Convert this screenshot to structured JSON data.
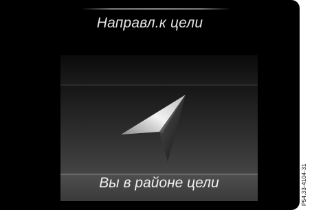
{
  "screen": {
    "title": "Направл.к цели",
    "status_message": "Вы в районе цели",
    "direction_icon": "navigation-arrow-icon"
  },
  "figure_ref": "P54.33-4104-31",
  "colors": {
    "screen_bg": "#000000",
    "text": "#e6e6e6",
    "arrow_light": "#e0e0e0",
    "arrow_dark": "#2a2a2a"
  }
}
